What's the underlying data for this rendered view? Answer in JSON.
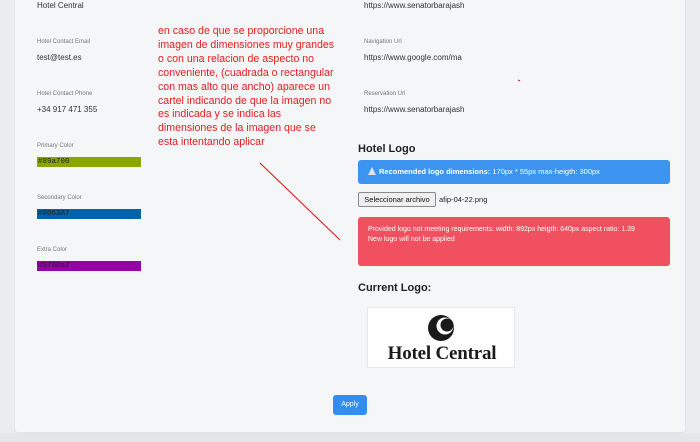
{
  "left": {
    "hotel_name": "Hotel Central",
    "email_label": "Hotel Contact Email",
    "email_value": "test@test.es",
    "phone_label": "Hotel Contact Phone",
    "phone_value": "+34 917 471 355",
    "primary_label": "Primary Color",
    "primary_value": "#89a700",
    "secondary_label": "Secondary Color",
    "secondary_value": "#0063A7",
    "extra_label": "Extra Color",
    "extra_value": "#9700a7"
  },
  "colors": {
    "primary": "#89a700",
    "secondary": "#0063A7",
    "extra": "#9700a7"
  },
  "right": {
    "booking_url": "https://www.senatorbarajash",
    "navigation_label": "Navigation Url",
    "navigation_value": "https://www.google.com/ma",
    "reservation_label": "Reservation Url",
    "reservation_value": "https://www.senatorbarajash"
  },
  "annotation": "en caso de que se proporcione una imagen de dimensiones muy grandes o con una relacion de aspecto no conveniente, (cuadrada o rectangular con mas alto que ancho) aparece un cartel indicando de que la imagen no es indicada y se indica las dimensiones de la imagen que se esta intentando aplicar",
  "logo": {
    "title": "Hotel Logo",
    "info_bold": "Recomended logo dimensions:",
    "info_rest": " 170px * 55px max-heigth: 300px",
    "file_button": "Seleccionar archivo",
    "file_name": "afip-04-22.png",
    "error_line1": "Provided logo not meeting requirements: width: 892px heigth: 640px aspect ratio: 1.39",
    "error_line2": "New logo will not be applied",
    "current_title": "Current Logo:",
    "logo_text": "Hotel Central"
  },
  "apply_label": "Apply"
}
